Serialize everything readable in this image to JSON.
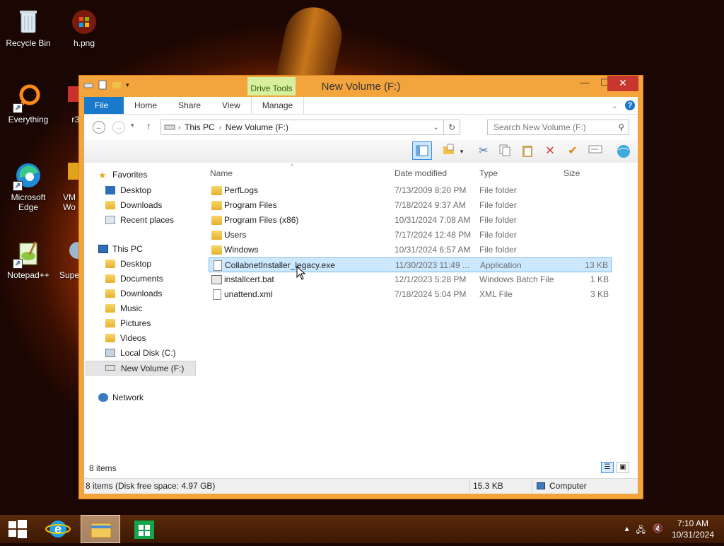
{
  "desktop": {
    "icons": [
      {
        "label": "Recycle Bin"
      },
      {
        "label": "h.png"
      },
      {
        "label": "Everything"
      },
      {
        "label": "r3"
      },
      {
        "label": "Microsoft Edge"
      },
      {
        "label": "VM Wo"
      },
      {
        "label": "Notepad++"
      },
      {
        "label": "Supe"
      }
    ]
  },
  "window": {
    "title": "New Volume (F:)",
    "contextual_tab": "Drive Tools",
    "ribbon_tabs": [
      "File",
      "Home",
      "Share",
      "View",
      "Manage"
    ],
    "controls": {
      "minimize": "—",
      "maximize": "☐",
      "close": "✕"
    }
  },
  "navbar": {
    "breadcrumb": [
      "This PC",
      "New Volume (F:)"
    ],
    "search_placeholder": "Search New Volume (F:)"
  },
  "nav_pane": {
    "favorites": {
      "label": "Favorites",
      "items": [
        "Desktop",
        "Downloads",
        "Recent places"
      ]
    },
    "this_pc": {
      "label": "This PC",
      "items": [
        "Desktop",
        "Documents",
        "Downloads",
        "Music",
        "Pictures",
        "Videos",
        "Local Disk (C:)",
        "New Volume (F:)"
      ]
    },
    "network": {
      "label": "Network"
    }
  },
  "columns": {
    "name": "Name",
    "date": "Date modified",
    "type": "Type",
    "size": "Size"
  },
  "files": [
    {
      "name": "PerfLogs",
      "date": "7/13/2009 8:20 PM",
      "type": "File folder",
      "size": "",
      "kind": "folder"
    },
    {
      "name": "Program Files",
      "date": "7/18/2024 9:37 AM",
      "type": "File folder",
      "size": "",
      "kind": "folder"
    },
    {
      "name": "Program Files (x86)",
      "date": "10/31/2024 7:08 AM",
      "type": "File folder",
      "size": "",
      "kind": "folder"
    },
    {
      "name": "Users",
      "date": "7/17/2024 12:48 PM",
      "type": "File folder",
      "size": "",
      "kind": "folder"
    },
    {
      "name": "Windows",
      "date": "10/31/2024 6:57 AM",
      "type": "File folder",
      "size": "",
      "kind": "folder"
    },
    {
      "name": "CollabnetInstaller_legacy.exe",
      "date": "11/30/2023 11:49 ...",
      "type": "Application",
      "size": "13 KB",
      "kind": "exe"
    },
    {
      "name": "installcert.bat",
      "date": "12/1/2023 5:28 PM",
      "type": "Windows Batch File",
      "size": "1 KB",
      "kind": "bat"
    },
    {
      "name": "unattend.xml",
      "date": "7/18/2024 5:04 PM",
      "type": "XML File",
      "size": "3 KB",
      "kind": "xml"
    }
  ],
  "content_footer": {
    "item_count": "8 items"
  },
  "status_bar": {
    "left": "8 items (Disk free space: 4.97 GB)",
    "size": "15.3 KB",
    "location": "Computer"
  },
  "taskbar": {
    "time": "7:10 AM",
    "date": "10/31/2024"
  },
  "colors": {
    "accent": "#1979ca",
    "window_frame": "#f4a43c",
    "selection": "#cce8ff",
    "contextual_tab": "#d9efa0"
  }
}
